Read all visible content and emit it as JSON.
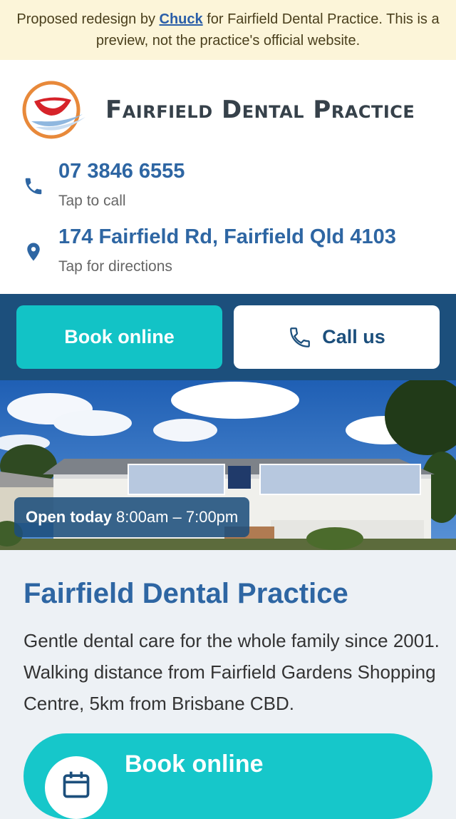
{
  "banner": {
    "prefix": "Proposed redesign by ",
    "author": "Chuck",
    "suffix": " for Fairfield Dental Practice. This is a preview, not the practice's official website."
  },
  "header": {
    "logo_text": "Fairfield Dental Practice",
    "phone": {
      "number": "07 3846 6555",
      "sub": "Tap to call",
      "icon": "phone-icon"
    },
    "address": {
      "text": "174 Fairfield Rd, Fairfield Qld 4103",
      "sub": "Tap for directions",
      "icon": "map-pin-icon"
    }
  },
  "cta": {
    "book_label": "Book online",
    "call_label": "Call us"
  },
  "hero": {
    "open_label": "Open today",
    "hours": "8:00am – 7:00pm"
  },
  "intro": {
    "title": "Fairfield Dental Practice",
    "text": "Gentle dental care for the whole family since 2001. Walking distance from Fairfield Gardens Shopping Centre, 5km from Brisbane CBD."
  },
  "book_pill": {
    "label": "Book online",
    "icon": "calendar-icon"
  },
  "colors": {
    "banner_bg": "#fcf5d9",
    "brand_blue": "#2e66a3",
    "navy": "#1c4f7c",
    "teal": "#12c3c6",
    "page_bg": "#edf1f5"
  }
}
